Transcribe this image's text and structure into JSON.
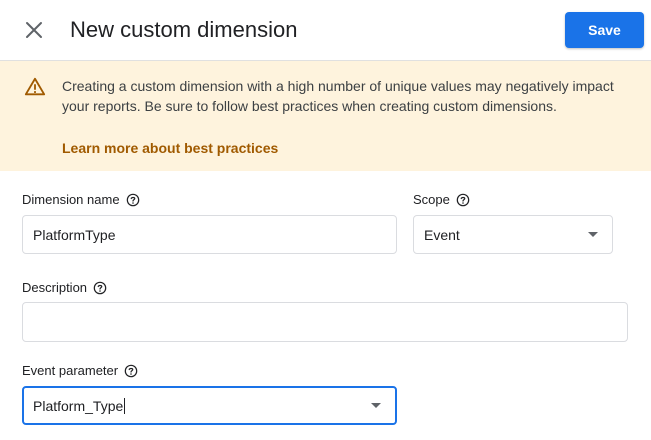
{
  "header": {
    "title": "New custom dimension",
    "save_label": "Save"
  },
  "banner": {
    "message": "Creating a custom dimension with a high number of unique values may negatively impact your reports. Be sure to follow best practices when creating custom dimensions.",
    "link": "Learn more about best practices"
  },
  "form": {
    "dimension_name": {
      "label": "Dimension name",
      "value": "PlatformType"
    },
    "scope": {
      "label": "Scope",
      "value": "Event"
    },
    "description": {
      "label": "Description",
      "value": ""
    },
    "event_parameter": {
      "label": "Event parameter",
      "value": "Platform_Type"
    }
  },
  "colors": {
    "accent": "#1a73e8",
    "banner_bg": "#fef3dd",
    "link": "#a05a00"
  }
}
